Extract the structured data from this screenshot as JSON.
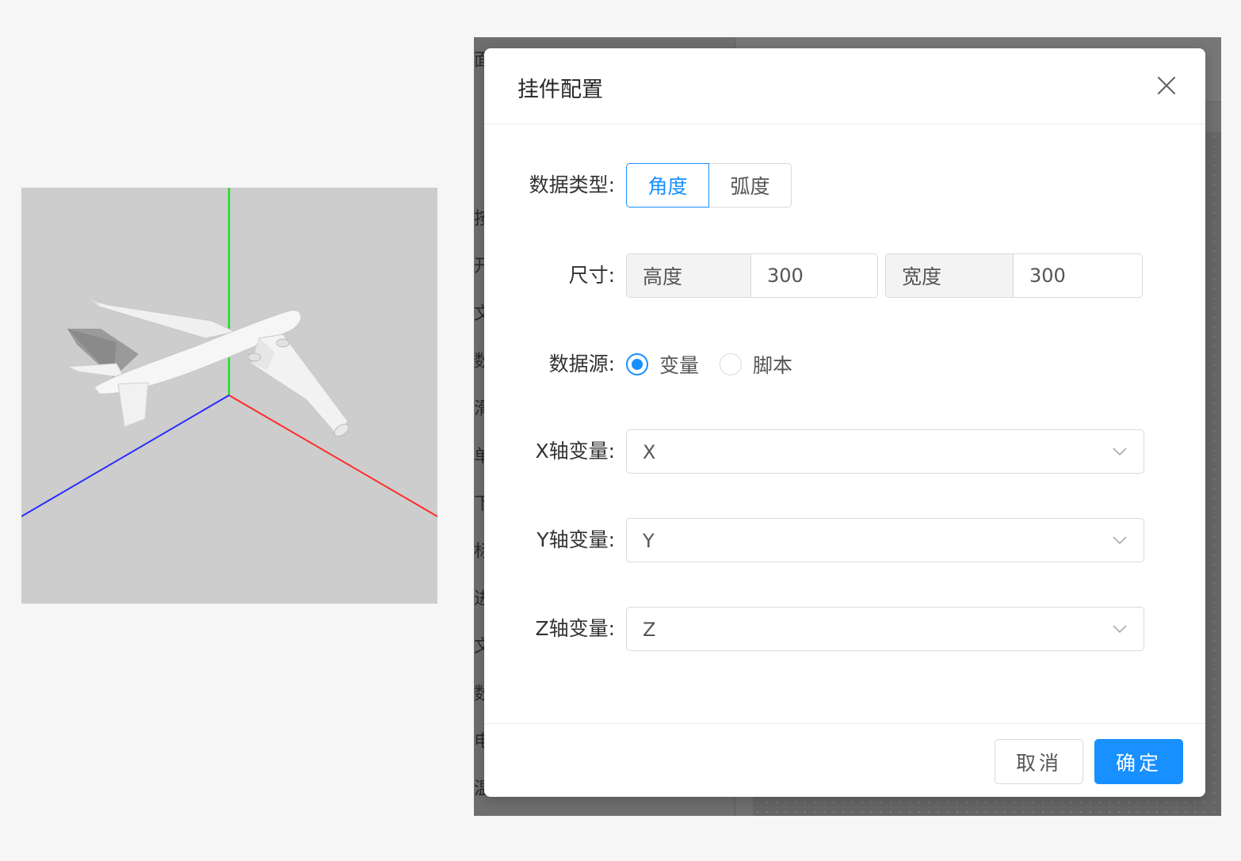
{
  "modal": {
    "title": "挂件配置",
    "data_type": {
      "label": "数据类型:",
      "options": [
        "角度",
        "弧度"
      ],
      "selected": "角度"
    },
    "size": {
      "label": "尺寸:",
      "height_label": "高度",
      "height_value": "300",
      "width_label": "宽度",
      "width_value": "300"
    },
    "data_source": {
      "label": "数据源:",
      "options": [
        "变量",
        "脚本"
      ],
      "selected": "变量"
    },
    "x_axis": {
      "label": "X轴变量:",
      "value": "X"
    },
    "y_axis": {
      "label": "Y轴变量:",
      "value": "Y"
    },
    "z_axis": {
      "label": "Z轴变量:",
      "value": "Z"
    },
    "cancel_label": "取消",
    "ok_label": "确定"
  },
  "background_panel": {
    "row_chars": [
      "面",
      "按",
      "开",
      "文",
      "数",
      "滑",
      "单",
      "下",
      "标",
      "进",
      "文",
      "数",
      "电",
      "温"
    ]
  },
  "colors": {
    "accent": "#1890ff",
    "axis_x": "#ff2a2a",
    "axis_y": "#22dd22",
    "axis_z": "#2a2aff",
    "viewport_bg": "#cdcdcd"
  }
}
